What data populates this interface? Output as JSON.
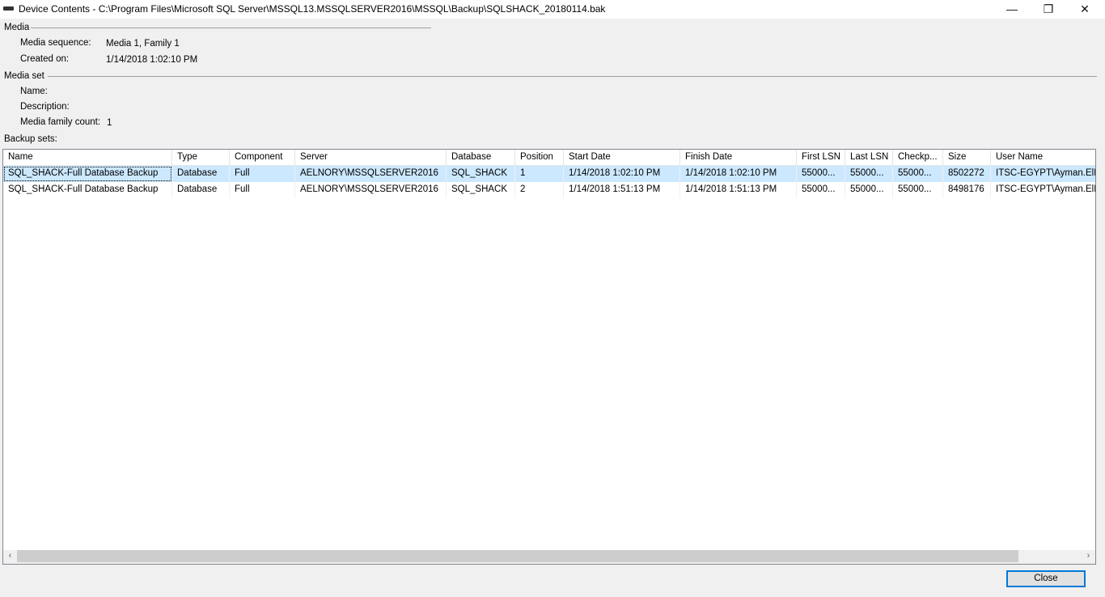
{
  "window": {
    "title": "Device Contents - C:\\Program Files\\Microsoft SQL Server\\MSSQL13.MSSQLSERVER2016\\MSSQL\\Backup\\SQLSHACK_20180114.bak",
    "minimize": "—",
    "restore": "❐",
    "close": "✕"
  },
  "media": {
    "heading": "Media",
    "sequence_label": "Media sequence:",
    "sequence_value": "Media 1, Family 1",
    "created_label": "Created on:",
    "created_value": "1/14/2018 1:02:10 PM"
  },
  "media_set": {
    "heading": "Media set",
    "name_label": "Name:",
    "description_label": "Description:",
    "family_count_label": "Media family count:",
    "family_count_value": "1"
  },
  "backup_sets": {
    "label": "Backup sets:",
    "columns": [
      "Name",
      "Type",
      "Component",
      "Server",
      "Database",
      "Position",
      "Start Date",
      "Finish Date",
      "First LSN",
      "Last LSN",
      "Checkp...",
      "Size",
      "User Name"
    ],
    "rows": [
      [
        "SQL_SHACK-Full Database Backup",
        "Database",
        "Full",
        "AELNORY\\MSSQLSERVER2016",
        "SQL_SHACK",
        "1",
        "1/14/2018 1:02:10 PM",
        "1/14/2018 1:02:10 PM",
        "55000...",
        "55000...",
        "55000...",
        "8502272",
        "ITSC-EGYPT\\Ayman.ElNo"
      ],
      [
        "SQL_SHACK-Full Database Backup",
        "Database",
        "Full",
        "AELNORY\\MSSQLSERVER2016",
        "SQL_SHACK",
        "2",
        "1/14/2018 1:51:13 PM",
        "1/14/2018 1:51:13 PM",
        "55000...",
        "55000...",
        "55000...",
        "8498176",
        "ITSC-EGYPT\\Ayman.ElNo"
      ]
    ],
    "selected_row": 0,
    "scroll_left": "‹",
    "scroll_right": "›"
  },
  "buttons": {
    "close": "Close"
  }
}
